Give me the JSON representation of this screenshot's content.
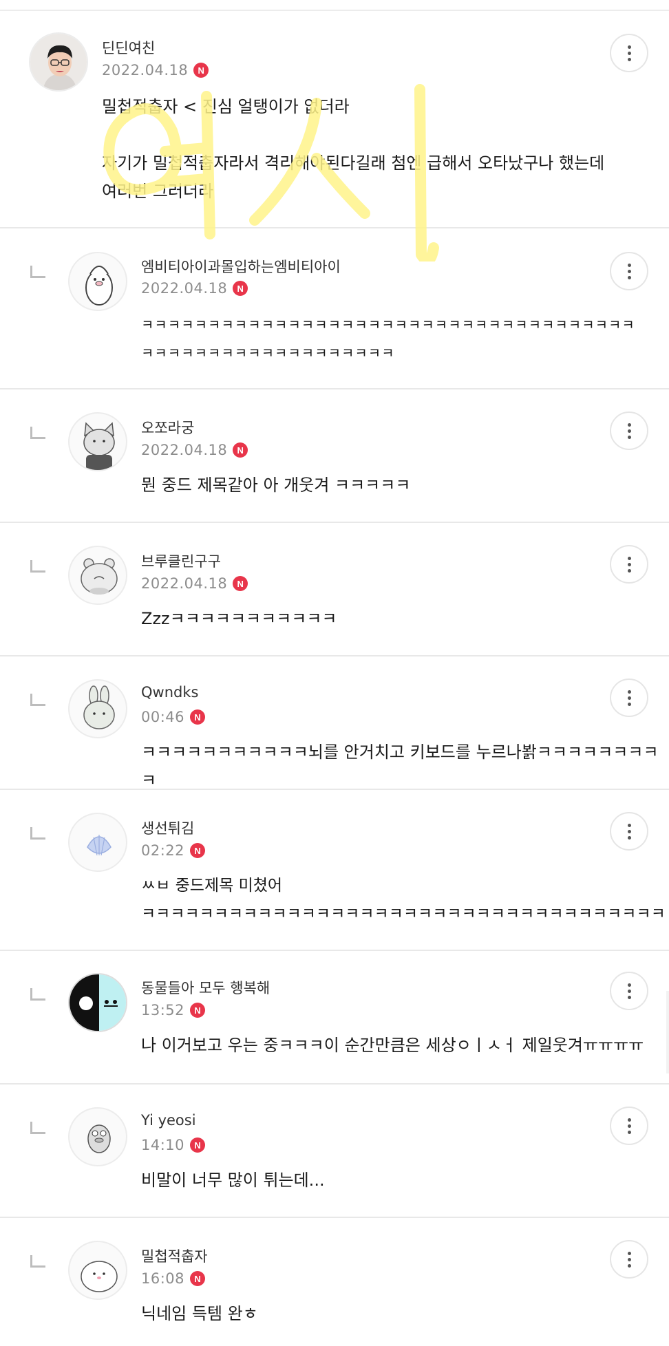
{
  "comments": [
    {
      "name": "딘딘여친",
      "date": "2022.04.18",
      "badge": "N",
      "text": "밀첩적춥자 < 진심 얼탱이가 없더라\n\n자기가 밀첩적춥자라서 격리해야된다길래 첨엔 급해서 오타났구나 했는데\n여러번 그러더라",
      "avatar": "profile-photo"
    },
    {
      "name": "엠비티아이과몰입하는엠비티아이",
      "date": "2022.04.18",
      "badge": "N",
      "text": "ㅋㅋㅋㅋㅋㅋㅋㅋㅋㅋㅋㅋㅋㅋㅋㅋㅋㅋㅋㅋㅋㅋㅋㅋㅋㅋㅋㅋㅋㅋㅋㅋㅋㅋㅋㅋㅋ\nㅋㅋㅋㅋㅋㅋㅋㅋㅋㅋㅋㅋㅋㅋㅋㅋㅋㅋㅋ",
      "avatar": "penguin-avatar"
    },
    {
      "name": "오쪼라궁",
      "date": "2022.04.18",
      "badge": "N",
      "text": "뭔 중드 제목같아 아 개웃겨 ㅋㅋㅋㅋㅋ",
      "avatar": "cat-avatar"
    },
    {
      "name": "브루클린구구",
      "date": "2022.04.18",
      "badge": "N",
      "text": "Zzzㅋㅋㅋㅋㅋㅋㅋㅋㅋㅋㅋ",
      "avatar": "hamster-avatar"
    },
    {
      "name": "Qwndks",
      "date": "00:46",
      "badge": "N",
      "text": "ㅋㅋㅋㅋㅋㅋㅋㅋㅋㅋㅋ뇌를 안거치고 키보드를 누르나봙ㅋㅋㅋㅋㅋㅋㅋㅋㅋ",
      "avatar": "rabbit-avatar"
    },
    {
      "name": "생선튀김",
      "date": "02:22",
      "badge": "N",
      "text": "ㅆㅂ 중드제목 미쳤어\nㅋㅋㅋㅋㅋㅋㅋㅋㅋㅋㅋㅋㅋㅋㅋㅋㅋㅋㅋㅋㅋㅋㅋㅋㅋㅋㅋㅋㅋㅋㅋㅋㅋㅋㅋㅋ",
      "avatar": "shell-avatar"
    },
    {
      "name": "동물들아 모두 행복해",
      "date": "13:52",
      "badge": "N",
      "text": "나 이거보고 우는 중ㅋㅋㅋ이 순간만큼은 세상ㅇㅣㅅㅓ 제일웃겨ㅠㅠㅠㅠ",
      "avatar": "bird-avatar"
    },
    {
      "name": "Yi yeosi",
      "date": "14:10",
      "badge": "N",
      "text": "비말이 너무 많이 튀는데...",
      "avatar": "duck-avatar"
    },
    {
      "name": "밀첩적춥자",
      "date": "16:08",
      "badge": "N",
      "text": "닉네임 득템 완ㅎ",
      "avatar": "blob-avatar"
    }
  ],
  "watermark_text": "여시",
  "colors": {
    "badge": "#e8354a",
    "watermark": "#fff48a",
    "divider": "#e8e8e8"
  }
}
